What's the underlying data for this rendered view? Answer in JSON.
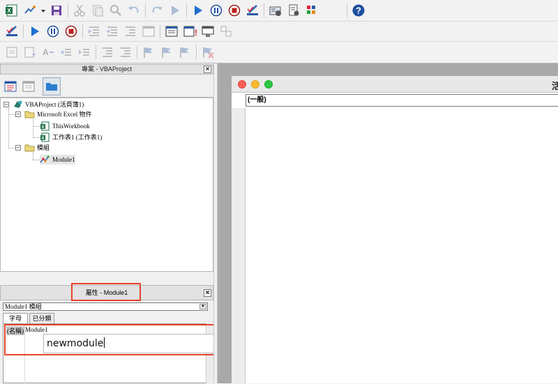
{
  "toolbar1": [
    "excel-icon",
    "insert-form-icon",
    "dropdown-arrow-icon",
    "save-icon",
    "cut-icon",
    "copy-icon",
    "find-icon",
    "undo-icon",
    "redo-icon",
    "run-icon",
    "run-sub-icon",
    "break-icon",
    "reset-icon",
    "design-mode-icon",
    "project-explorer-icon",
    "properties-icon",
    "toolbox-icon",
    "help-icon"
  ],
  "toolbar2": [
    "design-mode-icon",
    "run-icon",
    "break-icon",
    "reset-icon",
    "indent-icon",
    "outdent-icon",
    "comment-icon",
    "view-code-icon",
    "breakpoint-icon",
    "watch-icon",
    "stack-icon"
  ],
  "toolbar3": [
    "step-into-icon",
    "step-over-icon",
    "step-out-icon",
    "toggle-breakpoint-icon",
    "clear-breakpoints-icon",
    "comment-block-icon",
    "uncomment-block-icon",
    "bookmark-icon",
    "next-bookmark-icon",
    "prev-bookmark-icon",
    "clear-bookmarks-icon"
  ],
  "project": {
    "title": "專案 - VBAProject",
    "root": "VBAProject (活頁簿1)",
    "folder_objects": "Microsoft Excel 物件",
    "thisworkbook": "ThisWorkbook",
    "sheet1": "工作表1 (工作表1)",
    "folder_modules": "模組",
    "module1": "Module1"
  },
  "properties": {
    "title": "屬性 - Module1",
    "object_combo": "Module1  模組",
    "tab_alpha": "字母",
    "tab_category": "已分類",
    "prop_name": "(名稱)",
    "prop_value": "Module1",
    "edit_value": "newmodule"
  },
  "code_window": {
    "title_partial": "活",
    "object_combo": "(一般)"
  },
  "colors": {
    "highlight": "#e8432b",
    "mac_close": "#fc5f57",
    "mac_min": "#fdbc2e",
    "mac_max": "#28c840"
  }
}
